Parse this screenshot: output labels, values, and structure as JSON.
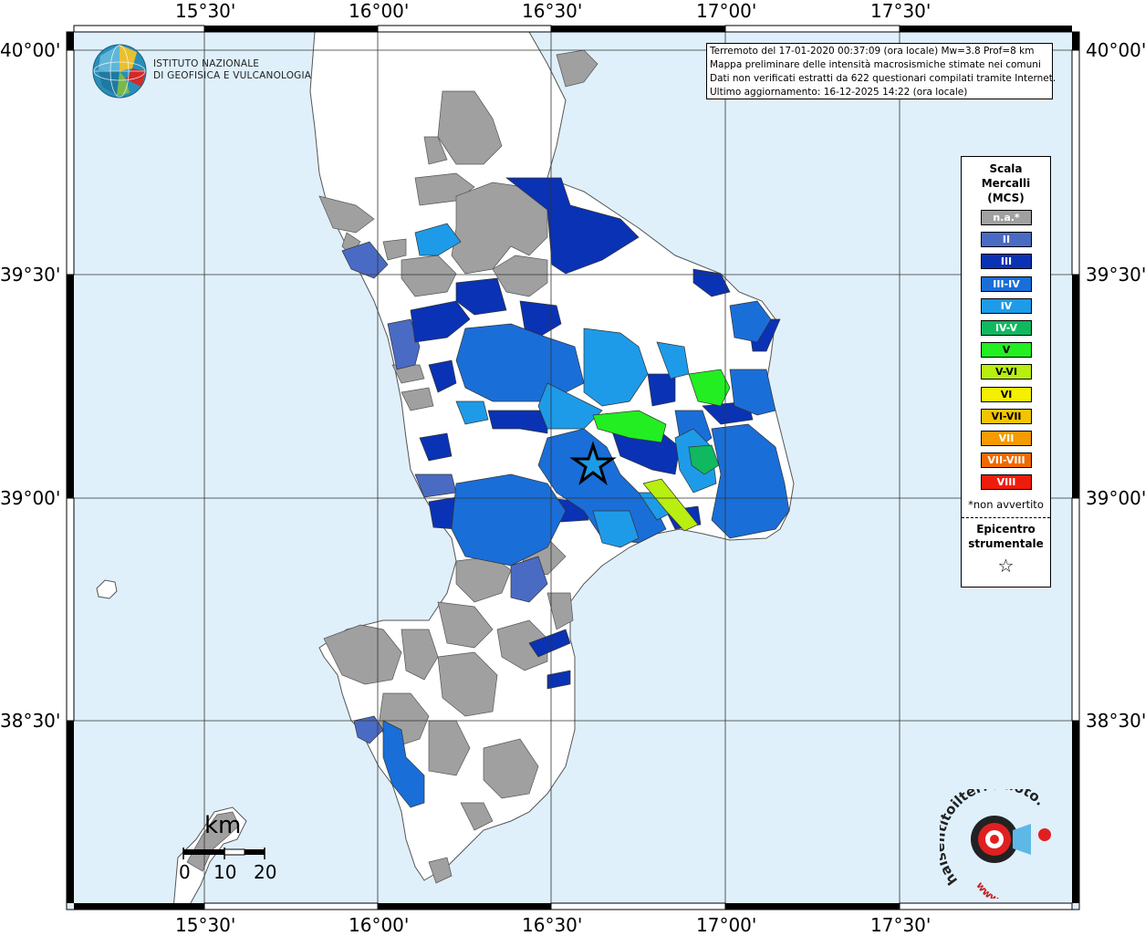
{
  "map": {
    "lon_labels": [
      "15°30'",
      "16°00'",
      "16°30'",
      "17°00'",
      "17°30'"
    ],
    "lat_labels": [
      "40°00'",
      "39°30'",
      "39°00'",
      "38°30'"
    ],
    "sea_color": "#dff0fb",
    "land_color": "#ffffff",
    "na_color": "#a0a0a0"
  },
  "info": {
    "line1": "Terremoto del 17-01-2020 00:37:09 (ora locale) Mw=3.8 Prof=8 km",
    "line2": "Mappa preliminare delle intensità macrosismiche stimate nei comuni",
    "line3": "Dati non verificati estratti da 622 questionari compilati tramite Internet.",
    "line4": "Ultimo aggiornamento: 16-12-2025 14:22 (ora locale)"
  },
  "logo_ingv": {
    "line1": "ISTITUTO NAZIONALE",
    "line2": "DI GEOFISICA E VULCANOLOGIA"
  },
  "legend": {
    "title1": "Scala",
    "title2": "Mercalli",
    "title3": "(MCS)",
    "items": [
      {
        "label": "n.a.*",
        "color": "#a0a0a0"
      },
      {
        "label": "II",
        "color": "#4a6bc4"
      },
      {
        "label": "III",
        "color": "#0a32b4"
      },
      {
        "label": "III-IV",
        "color": "#1a6ed8"
      },
      {
        "label": "IV",
        "color": "#1e9be8"
      },
      {
        "label": "IV-V",
        "color": "#10b860"
      },
      {
        "label": "V",
        "color": "#22ee22"
      },
      {
        "label": "V-VI",
        "color": "#b8ee10"
      },
      {
        "label": "VI",
        "color": "#f5f000"
      },
      {
        "label": "VI-VII",
        "color": "#f5c400"
      },
      {
        "label": "VII",
        "color": "#f59a00"
      },
      {
        "label": "VII-VIII",
        "color": "#f06a00"
      },
      {
        "label": "VIII",
        "color": "#ee1c0c"
      }
    ],
    "note": "*non avvertito",
    "epicentro1": "Epicentro",
    "epicentro2": "strumentale",
    "star": "☆"
  },
  "scale": {
    "unit": "km",
    "labels": [
      "0",
      "10",
      "20"
    ]
  },
  "hsit_logo": {
    "text": "haisentitoilterremoto.it",
    "www": "www."
  },
  "icons": [
    "ingv-globe-icon",
    "epicenter-star-icon",
    "hsit-logo-icon"
  ]
}
